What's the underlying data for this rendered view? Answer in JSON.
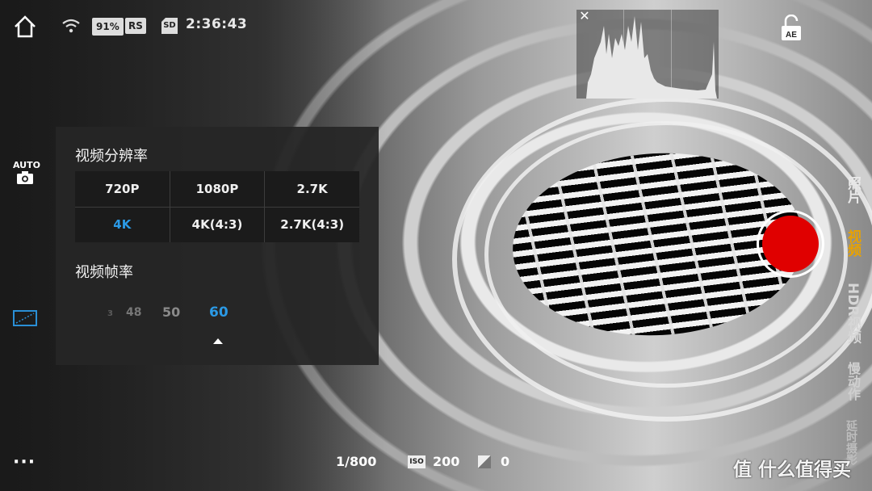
{
  "status": {
    "battery": "91%",
    "rs": "RS",
    "sd": "SD",
    "time": "2:36:43"
  },
  "left": {
    "auto_label": "AUTO"
  },
  "panel": {
    "resolution_title": "视频分辨率",
    "resolutions": [
      "720P",
      "1080P",
      "2.7K",
      "4K",
      "4K(4:3)",
      "2.7K(4:3)"
    ],
    "selected_resolution": "4K",
    "framerate_title": "视频帧率",
    "framerates": [
      "48",
      "50",
      "60"
    ],
    "framerate_faded_partial": "3",
    "selected_framerate": "60"
  },
  "modes": {
    "photo": "照片",
    "video": "视频",
    "hdr_video": "HDR视频",
    "slow_motion": "慢动作",
    "timelapse": "延时摄影",
    "selected": "视频"
  },
  "bottom": {
    "shutter": "1/800",
    "iso_label": "ISO",
    "iso_value": "200",
    "ev_value": "0"
  },
  "watermark": "值 什么值得买",
  "ae_label": "AE",
  "colors": {
    "accent_blue": "#2b9ae6",
    "mode_selected": "#e8a200",
    "record_red": "#e00000"
  },
  "icons": [
    "home-icon",
    "wifi-icon",
    "close-icon",
    "ae-lock-icon",
    "camera-icon",
    "gallery-icon",
    "iso-icon",
    "exposure-icon"
  ]
}
